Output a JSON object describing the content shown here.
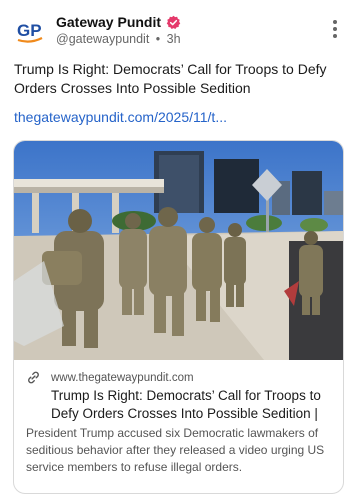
{
  "post": {
    "account_name": "Gateway Pundit",
    "handle": "@gatewaypundit",
    "separator": "•",
    "time": "3h",
    "avatar_text": "GP",
    "text": "Trump Is Right: Democrats’ Call for Troops to Defy Orders Crosses Into Possible Sedition",
    "link_text": "thegatewaypundit.com/2025/11/t..."
  },
  "card": {
    "domain": "www.thegatewaypundit.com",
    "title": "Trump Is Right: Democrats’ Call for Troops to Defy Orders Crosses Into Possible Sedition | T...",
    "description": "President Trump accused six Democratic lawmakers of seditious behavior after they released a video urging US service members to refuse illegal orders."
  },
  "colors": {
    "link": "#2563c9",
    "verified": "#e5396b",
    "avatar_blue": "#1f4ea3",
    "avatar_orange": "#f08a1c"
  },
  "icons": {
    "verified": "verified-badge-icon",
    "more": "more-vertical-icon",
    "chain": "link-chain-icon"
  }
}
